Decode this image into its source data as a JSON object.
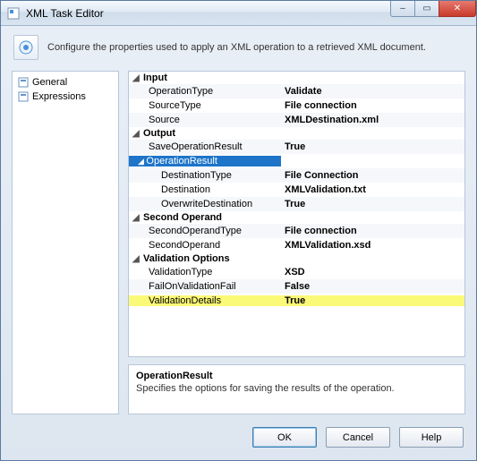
{
  "window": {
    "title": "XML Task Editor",
    "description": "Configure the properties used to apply an XML operation to a retrieved XML document."
  },
  "nav": {
    "items": [
      {
        "label": "General"
      },
      {
        "label": "Expressions"
      }
    ]
  },
  "grid": {
    "categories": [
      {
        "name": "Input",
        "props": [
          {
            "name": "OperationType",
            "value": "Validate"
          },
          {
            "name": "SourceType",
            "value": "File connection"
          },
          {
            "name": "Source",
            "value": "XMLDestination.xml"
          }
        ]
      },
      {
        "name": "Output",
        "props": [
          {
            "name": "SaveOperationResult",
            "value": "True"
          },
          {
            "name": "OperationResult",
            "value": "",
            "selected": true,
            "expandable": true
          },
          {
            "name": "DestinationType",
            "value": "File Connection",
            "sub": true
          },
          {
            "name": "Destination",
            "value": "XMLValidation.txt",
            "sub": true
          },
          {
            "name": "OverwriteDestination",
            "value": "True",
            "sub": true
          }
        ]
      },
      {
        "name": "Second Operand",
        "props": [
          {
            "name": "SecondOperandType",
            "value": "File connection"
          },
          {
            "name": "SecondOperand",
            "value": "XMLValidation.xsd"
          }
        ]
      },
      {
        "name": "Validation Options",
        "props": [
          {
            "name": "ValidationType",
            "value": "XSD"
          },
          {
            "name": "FailOnValidationFail",
            "value": "False"
          },
          {
            "name": "ValidationDetails",
            "value": "True",
            "highlight": true
          }
        ]
      }
    ]
  },
  "help": {
    "title": "OperationResult",
    "desc": "Specifies the options for saving the results of the operation."
  },
  "buttons": {
    "ok": "OK",
    "cancel": "Cancel",
    "help": "Help"
  },
  "winControls": {
    "min": "–",
    "max": "▭",
    "close": "✕"
  }
}
